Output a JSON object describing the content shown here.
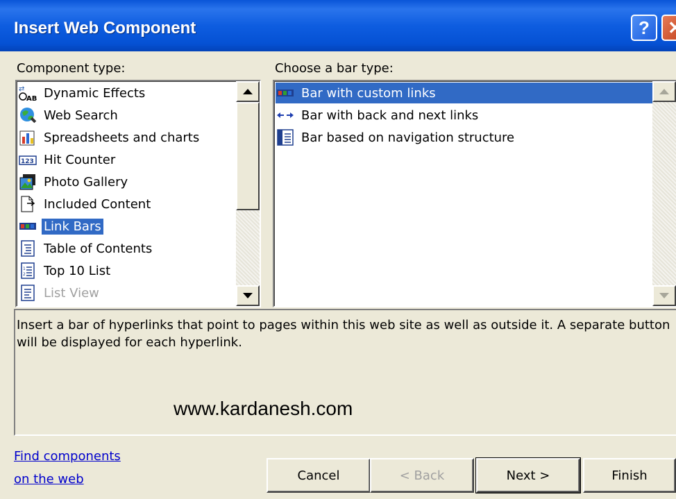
{
  "window": {
    "title": "Insert Web Component",
    "help_glyph": "?",
    "close_glyph": "✕"
  },
  "component_type": {
    "label": "Component type:",
    "items": [
      {
        "label": "Dynamic Effects",
        "icon": "dynamic-effects-icon"
      },
      {
        "label": "Web Search",
        "icon": "web-search-icon"
      },
      {
        "label": "Spreadsheets and charts",
        "icon": "spreadsheet-chart-icon"
      },
      {
        "label": "Hit Counter",
        "icon": "hit-counter-icon"
      },
      {
        "label": "Photo Gallery",
        "icon": "photo-gallery-icon"
      },
      {
        "label": "Included Content",
        "icon": "included-content-icon"
      },
      {
        "label": "Link Bars",
        "icon": "link-bar-icon",
        "selected": true
      },
      {
        "label": "Table of Contents",
        "icon": "table-of-contents-icon"
      },
      {
        "label": "Top 10 List",
        "icon": "top-10-list-icon"
      },
      {
        "label": "List View",
        "icon": "list-view-icon",
        "disabled": true
      }
    ]
  },
  "bar_type": {
    "label": "Choose a bar type:",
    "items": [
      {
        "label": "Bar with custom links",
        "icon": "custom-links-bar-icon",
        "selected": true
      },
      {
        "label": "Bar with back and next links",
        "icon": "back-next-arrows-icon"
      },
      {
        "label": "Bar based on navigation structure",
        "icon": "navigation-structure-icon"
      }
    ]
  },
  "description": "Insert a bar of hyperlinks that point to pages within this web site as well as outside it.  A separate button will be displayed for each hyperlink.",
  "watermark": "www.kardanesh.com",
  "find_link": {
    "line1": "Find components",
    "line2": "on the web"
  },
  "buttons": {
    "cancel": "Cancel",
    "back": "< Back",
    "next": "Next >",
    "finish": "Finish"
  },
  "colors": {
    "title_bar": "#0a55d8",
    "selection": "#316ac5",
    "dialog_bg": "#ece9d8",
    "link": "#0000cc"
  }
}
